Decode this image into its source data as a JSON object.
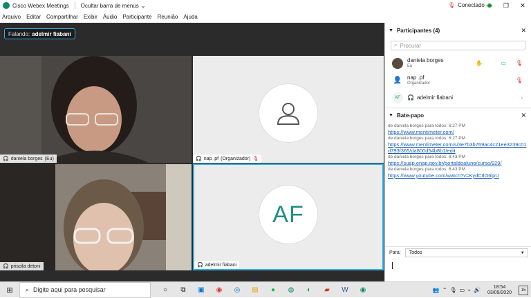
{
  "window": {
    "app_title": "Cisco Webex Meetings",
    "menu_toggle": "Ocultar barra de menus",
    "status": "Conectado",
    "minimize": "—",
    "maximize": "❐",
    "close": "✕"
  },
  "menu": [
    "Arquivo",
    "Editar",
    "Compartilhar",
    "Exibir",
    "Áudio",
    "Participante",
    "Reunião",
    "Ajuda"
  ],
  "speaking": {
    "prefix": "Falando:",
    "name": "adelmir fiabani"
  },
  "tiles": [
    {
      "name": "daniela borges",
      "suffix": "(Eu)"
    },
    {
      "name": "nap .pf",
      "suffix": "(Organizador)"
    },
    {
      "name": "priscila detoni",
      "suffix": ""
    },
    {
      "name": "adelmir fiabani",
      "suffix": "",
      "initials": "AF"
    }
  ],
  "participants": {
    "title": "Participantes (4)",
    "search_placeholder": "Procurar",
    "items": [
      {
        "name": "daniela borges",
        "role": "Eu"
      },
      {
        "name": "nap .pf",
        "role": "Organizador"
      },
      {
        "name": "adelmir fiabani",
        "role": "",
        "initials": "AF"
      }
    ]
  },
  "chat": {
    "title": "Bate-papo",
    "messages": [
      {
        "meta": "de daniela borges para todos:   6:27 PM",
        "text": "https://www.mentimeter.com/"
      },
      {
        "meta": "de daniela borges para todos:   6:27 PM",
        "text": "https://www.mentimeter.com/s/3e7b3b769ac4c21ee3239c01d793f365/da800d54b8b1/edit"
      },
      {
        "meta": "de daniela borges para todos:   6:43 PM",
        "text": "https://suap.enap.gov.br/portaldoaluno/curso/929/"
      },
      {
        "meta": "de daniela borges para todos:   6:43 PM",
        "text": "https://www.youtube.com/watch?v=KydCtlO6lpU"
      }
    ],
    "to_label": "Para:",
    "to_value": "Todos"
  },
  "taskbar": {
    "search_placeholder": "Digite aqui para pesquisar",
    "time": "18:54",
    "date": "03/09/2020",
    "notifications": "15"
  }
}
